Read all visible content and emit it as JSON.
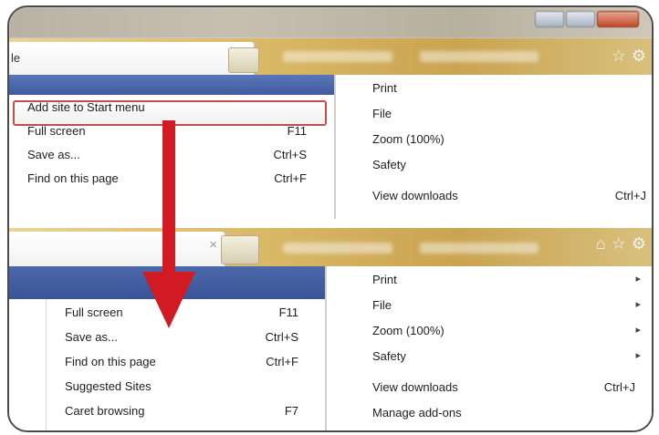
{
  "top": {
    "tab": {
      "title": "le",
      "close": "×"
    },
    "left_menu": {
      "items": [
        {
          "label": "Add site to Start menu",
          "shortcut": ""
        },
        {
          "label": "Full screen",
          "shortcut": "F11"
        },
        {
          "label": "Save as...",
          "shortcut": "Ctrl+S"
        },
        {
          "label": "Find on this page",
          "shortcut": "Ctrl+F"
        }
      ]
    },
    "right_menu": {
      "items": [
        {
          "label": "Print",
          "shortcut": ""
        },
        {
          "label": "File",
          "shortcut": ""
        },
        {
          "label": "Zoom (100%)",
          "shortcut": ""
        },
        {
          "label": "Safety",
          "shortcut": ""
        },
        {
          "label": "View downloads",
          "shortcut": "Ctrl+J"
        }
      ]
    }
  },
  "bottom": {
    "tab": {
      "close": "×"
    },
    "left_menu": {
      "items": [
        {
          "label": "Full screen",
          "shortcut": "F11"
        },
        {
          "label": "Save as...",
          "shortcut": "Ctrl+S"
        },
        {
          "label": "Find on this page",
          "shortcut": "Ctrl+F"
        },
        {
          "label": "Suggested Sites",
          "shortcut": ""
        },
        {
          "label": "Caret browsing",
          "shortcut": "F7"
        }
      ]
    },
    "right_menu": {
      "items": [
        {
          "label": "Print",
          "shortcut": "",
          "chevron": "▸"
        },
        {
          "label": "File",
          "shortcut": "",
          "chevron": "▸"
        },
        {
          "label": "Zoom (100%)",
          "shortcut": "",
          "chevron": "▸"
        },
        {
          "label": "Safety",
          "shortcut": "",
          "chevron": "▸"
        },
        {
          "label": "View downloads",
          "shortcut": "Ctrl+J",
          "chevron": ""
        },
        {
          "label": "Manage add-ons",
          "shortcut": "",
          "chevron": ""
        }
      ]
    }
  },
  "colors": {
    "highlight_border": "#c84a4a",
    "arrow": "#d11a22",
    "menu_header": "#3f5a9e"
  },
  "icons": [
    "star-icon",
    "gear-icon",
    "home-icon"
  ]
}
